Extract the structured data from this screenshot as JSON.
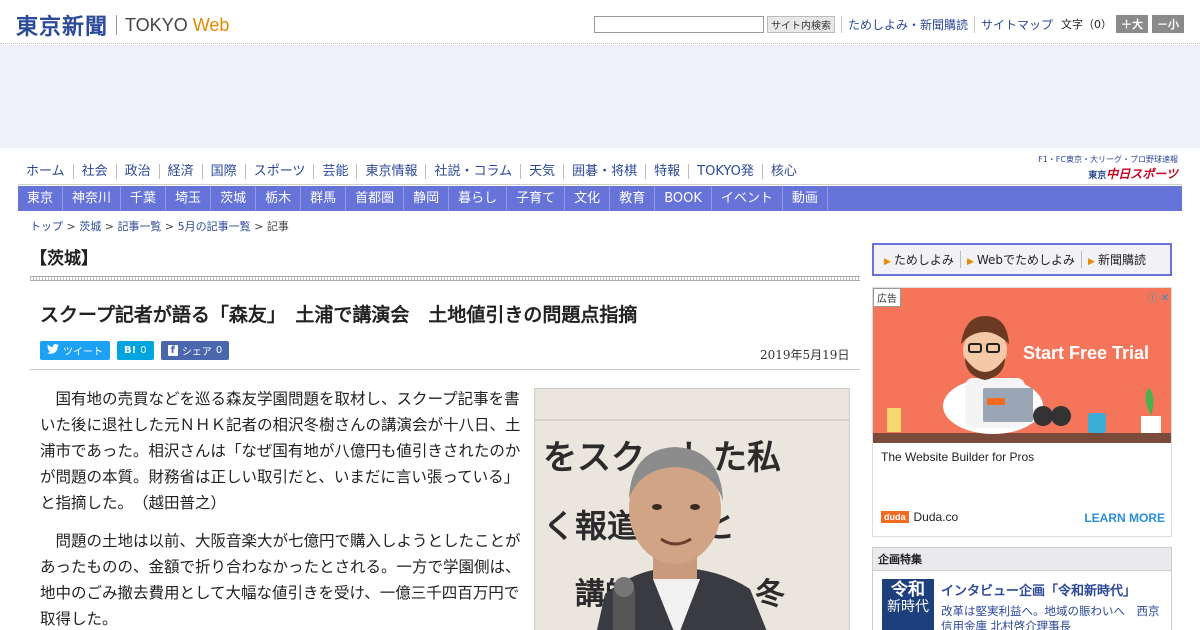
{
  "header": {
    "logo_jp": "東京新聞",
    "logo_en_tokyo": "TOKYO",
    "logo_en_web": "Web",
    "search_button": "サイト内検索",
    "links": [
      "ためしよみ・新聞購読",
      "サイトマップ"
    ],
    "font_label": "文字（0）",
    "font_larger": "＋大",
    "font_smaller": "－小"
  },
  "nav_primary": [
    "ホーム",
    "社会",
    "政治",
    "経済",
    "国際",
    "スポーツ",
    "芸能",
    "東京情報",
    "社説・コラム",
    "天気",
    "囲碁・将棋",
    "特報",
    "TOKYO発",
    "核心"
  ],
  "nav_right": {
    "small": "F1・FC東京・大リーグ・プロ野球速報",
    "brand_prefix": "東京",
    "brand": "中日スポーツ"
  },
  "nav_secondary": [
    "東京",
    "神奈川",
    "千葉",
    "埼玉",
    "茨城",
    "栃木",
    "群馬",
    "首都圏",
    "静岡",
    "暮らし",
    "子育て",
    "文化",
    "教育",
    "BOOK",
    "イベント",
    "動画"
  ],
  "breadcrumb": {
    "items": [
      "トップ",
      "茨城",
      "記事一覧",
      "5月の記事一覧"
    ],
    "sep": " > ",
    "current": "記事"
  },
  "article": {
    "category": "【茨城】",
    "headline": "スクープ記者が語る「森友」　土浦で講演会　土地値引きの問題点指摘",
    "date": "2019年5月19日",
    "share": {
      "tweet": "ツイート",
      "hatena_icon": "B!",
      "hatena_count": "0",
      "fb_icon": "f",
      "fb_label": "シェア",
      "fb_count": "0"
    },
    "paragraphs": [
      "国有地の売買などを巡る森友学園問題を取材し、スクープ記事を書いた後に退社した元ＮＨＫ記者の相沢冬樹さんの講演会が十八日、土浦市であった。相沢さんは「なぜ国有地が八億円も値引きされたのかが問題の本質。財務省は正しい取引だと、いまだに言い張っている」と指摘した。　（越田普之）",
      "問題の土地は以前、大阪音楽大が七億円で購入しようとしたことがあったものの、金額で折り合わなかったとされる。一方で学園側は、地中のごみ撤去費用として大幅な値引きを受け、一億三千四百万円で取得した。"
    ],
    "photo_banner_text": "をスク　した私",
    "photo_banner_text2": "く報道　裏と",
    "photo_banner_text3": "講師　　澤　冬"
  },
  "sidebar": {
    "subnav": [
      "ためしよみ",
      "Webでためしよみ",
      "新聞購読"
    ],
    "ad": {
      "badge": "広告",
      "cta": "Start Free Trial",
      "text": "The Website Builder for Pros",
      "brand_logo": "duda",
      "brand": "Duda.co",
      "learn_more": "LEARN MORE"
    },
    "feature": {
      "heading": "企画特集",
      "thumb_line1": "令和",
      "thumb_line2": "新時代",
      "title": "インタビュー企画「令和新時代」",
      "desc": "改革は堅実利益へ。地域の賑わいへ　西京信用金庫 北村啓介理事長"
    }
  },
  "colors": {
    "brand_blue": "#2c4a9a",
    "nav_purple": "#6674d9",
    "accent_orange": "#e58a00",
    "ad_coral": "#f4755a"
  }
}
